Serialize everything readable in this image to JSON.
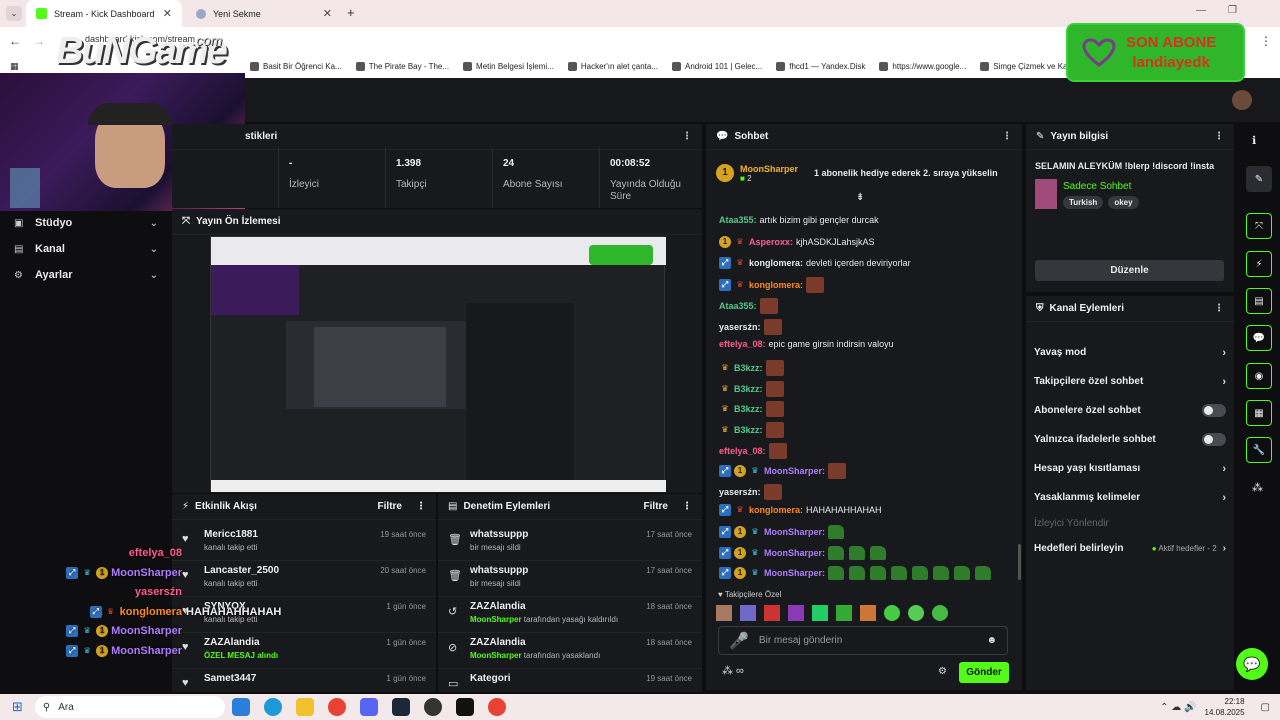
{
  "browser": {
    "tabs": [
      {
        "label": "Stream - Kick Dashboard"
      },
      {
        "label": "Yeni Sekme"
      }
    ],
    "new_tab": "+",
    "url": "dashboard.kick.com/stream",
    "bookmarks": [
      "Basit Bir Öğrenci Ka...",
      "The Pirate Bay - The...",
      "Metin Belgesi İşlemi...",
      "Hacker'ın alet çanta...",
      "Android 101 | Gelec...",
      "fhcd1 — Yandex.Disk",
      "https://www.google...",
      "Simge Çizmek ve Ka...",
      "Dav..."
    ]
  },
  "overlay": {
    "logo_text": "BuNGame",
    "logo_sub": ".com",
    "alert_title": "SON ABONE",
    "alert_name": "landiayedk",
    "chat": [
      {
        "user": "eftelya_08",
        "color": "#ff5d8f",
        "badges": [],
        "text": ""
      },
      {
        "user": "MoonSharper",
        "color": "#b07cff",
        "badges": [
          "blue",
          "cyan",
          "gold"
        ],
        "text": ""
      },
      {
        "user": "yasersźn",
        "color": "#ff5d8f",
        "badges": [],
        "text": ""
      },
      {
        "user": "konglomera",
        "color": "#ff8a1c",
        "badges": [
          "blue",
          "red"
        ],
        "text": "HAHAHAHHAHAH"
      },
      {
        "user": "MoonSharper",
        "color": "#b07cff",
        "badges": [
          "blue",
          "cyan",
          "gold"
        ],
        "text": ""
      },
      {
        "user": "MoonSharper",
        "color": "#b07cff",
        "badges": [
          "blue",
          "cyan",
          "gold"
        ],
        "text": ""
      }
    ]
  },
  "sidebar": {
    "items": [
      {
        "label": "Stüdyo",
        "icon": "studio-icon"
      },
      {
        "label": "Kanal",
        "icon": "channel-icon"
      },
      {
        "label": "Ayarlar",
        "icon": "gear-icon"
      }
    ]
  },
  "stats": {
    "header": "stikleri",
    "items": [
      {
        "value": "-",
        "label": "İzleyici"
      },
      {
        "value": "1.398",
        "label": "Takipçi"
      },
      {
        "value": "24",
        "label": "Abone Sayısı"
      },
      {
        "value": "00:08:52",
        "label": "Yayında Olduğu Süre"
      }
    ]
  },
  "preview": {
    "title": "Yayın Ön İzlemesi"
  },
  "activity": {
    "title": "Etkinlik Akışı",
    "filter": "Filtre",
    "rows": [
      {
        "name": "Mericc1881",
        "sub": "kanalı takip etti",
        "time": "19 saat önce",
        "icon": "heart-icon"
      },
      {
        "name": "Lancaster_2500",
        "sub": "kanalı takip etti",
        "time": "20 saat önce",
        "icon": "heart-icon"
      },
      {
        "name": "SYNYOX",
        "sub": "kanalı takip etti",
        "time": "1 gün önce",
        "icon": "heart-icon"
      },
      {
        "name": "ZAZAlandia",
        "sub": "ÖZEL MESAJ alındı",
        "time": "1 gün önce",
        "icon": "heart-icon"
      },
      {
        "name": "Samet3447",
        "sub": "",
        "time": "1 gün önce",
        "icon": "heart-icon"
      }
    ]
  },
  "moderation": {
    "title": "Denetim Eylemleri",
    "filter": "Filtre",
    "rows": [
      {
        "name": "whatssuppp",
        "sub": "bir mesajı sildi",
        "time": "17 saat önce",
        "icon": "trash-icon"
      },
      {
        "name": "whatssuppp",
        "sub": "bir mesajı sildi",
        "time": "17 saat önce",
        "icon": "trash-icon"
      },
      {
        "name": "ZAZAlandia",
        "sub_user": "MoonSharper",
        "sub": "tarafından yasağı kaldırıldı",
        "time": "18 saat önce",
        "icon": "undo-icon"
      },
      {
        "name": "ZAZAlandia",
        "sub_user": "MoonSharper",
        "sub": "tarafından yasaklandı",
        "time": "18 saat önce",
        "icon": "ban-icon"
      },
      {
        "name": "Kategori",
        "sub": "",
        "time": "19 saat önce",
        "icon": "category-icon"
      }
    ]
  },
  "chat": {
    "title": "Sohbet",
    "pinned_user": "MoonSharper",
    "pinned_count": "2",
    "pinned_text": "1 abonelik hediye ederek 2. sıraya yükselin",
    "messages": [
      {
        "user": "Ataa355",
        "color": "#53c98a",
        "badges": [],
        "text": "artık bizim gibi gençler durcak",
        "emotes": 0
      },
      {
        "user": "Asperoxx",
        "color": "#ff5d8f",
        "badges": [
          "gold",
          "red"
        ],
        "text": "kjhASDKJLahsjkAS",
        "emotes": 0
      },
      {
        "user": "konglomera",
        "color": "#e8e8ea",
        "badges": [
          "blue",
          "red"
        ],
        "text": "devleti içerden deviriyorlar",
        "emotes": 0
      },
      {
        "user": "konglomera",
        "color": "#ff8a1c",
        "badges": [
          "blue",
          "red"
        ],
        "text": "",
        "emotes": 1
      },
      {
        "user": "Ataa355",
        "color": "#53c98a",
        "badges": [],
        "text": "",
        "emotes": 1
      },
      {
        "user": "yasersźn",
        "color": "#e8e8ea",
        "badges": [],
        "text": "",
        "emotes": 1
      },
      {
        "user": "eftelya_08",
        "color": "#ff5d8f",
        "badges": [],
        "text": "epic game girsin indirsin valoyu",
        "emotes": 0
      },
      {
        "user": "B3kzz",
        "color": "#53c98a",
        "badges": [
          "cat"
        ],
        "text": "",
        "emotes": 1
      },
      {
        "user": "B3kzz",
        "color": "#53c98a",
        "badges": [
          "cat"
        ],
        "text": "",
        "emotes": 1
      },
      {
        "user": "B3kzz",
        "color": "#53c98a",
        "badges": [
          "cat"
        ],
        "text": "",
        "emotes": 1
      },
      {
        "user": "B3kzz",
        "color": "#53c98a",
        "badges": [
          "cat"
        ],
        "text": "",
        "emotes": 1
      },
      {
        "user": "eftelya_08",
        "color": "#ff5d8f",
        "badges": [],
        "text": "",
        "emotes": 1
      },
      {
        "user": "MoonSharper",
        "color": "#b07cff",
        "badges": [
          "blue",
          "gold",
          "cyan"
        ],
        "text": "",
        "emotes": 1
      },
      {
        "user": "yasersźn",
        "color": "#e8e8ea",
        "badges": [],
        "text": "",
        "emotes": 1
      },
      {
        "user": "konglomera",
        "color": "#ff8a1c",
        "badges": [
          "blue",
          "red"
        ],
        "text": "HAHAHAHHAHAH",
        "emotes": 0
      },
      {
        "user": "MoonSharper",
        "color": "#b07cff",
        "badges": [
          "blue",
          "gold",
          "cyan"
        ],
        "text": "",
        "horses": 1
      },
      {
        "user": "MoonSharper",
        "color": "#b07cff",
        "badges": [
          "blue",
          "gold",
          "cyan"
        ],
        "text": "",
        "horses": 3
      },
      {
        "user": "MoonSharper",
        "color": "#b07cff",
        "badges": [
          "blue",
          "gold",
          "cyan"
        ],
        "text": "",
        "horses": 8
      }
    ],
    "followers_label": "Takipçilere Özel",
    "input_placeholder": "Bir mesaj gönderin",
    "send_label": "Gönder"
  },
  "stream_info": {
    "title": "Yayın bilgisi",
    "stream_title": "SELAMIN ALEYKÜM !blerp !discord !insta",
    "category": "Sadece Sohbet",
    "tags": [
      "Turkish",
      "okey"
    ],
    "edit_label": "Düzenle"
  },
  "channel_actions": {
    "title": "Kanal Eylemleri",
    "rows": [
      {
        "label": "Yavaş mod",
        "control": "chevron"
      },
      {
        "label": "Takipçilere özel sohbet",
        "control": "chevron"
      },
      {
        "label": "Abonelere özel sohbet",
        "control": "toggle"
      },
      {
        "label": "Yalnızca ifadelerle sohbet",
        "control": "toggle"
      },
      {
        "label": "Hesap yaşı kısıtlaması",
        "control": "chevron"
      },
      {
        "label": "Yasaklanmış kelimeler",
        "control": "chevron"
      },
      {
        "label": "İzleyici Yönlendir",
        "control": "none"
      },
      {
        "label": "Hedefleri belirleyin",
        "control": "chevron"
      }
    ],
    "goals_status": "Aktif hedefler - 2"
  },
  "taskbar": {
    "search": "Ara",
    "time": "22:18",
    "date": "14.08.2025"
  },
  "colors": {
    "accent": "#53fc18",
    "bg": "#0e0e10",
    "panel": "#18191d"
  }
}
